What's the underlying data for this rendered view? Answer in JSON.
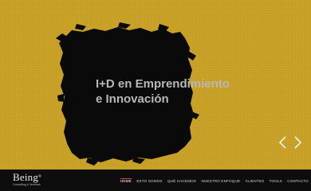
{
  "hero": {
    "headline_line1": "I+D en Emprendimiento",
    "headline_line2": "e Innovación",
    "background_color": "#c9a227",
    "brush_color": "#0a0a0a",
    "prev_icon": "chevron-left-icon",
    "next_icon": "chevron-right-icon"
  },
  "footer": {
    "logo": {
      "word": "Being",
      "mark": "®",
      "tagline": "Consulting & Ventures"
    },
    "nav": [
      {
        "label": "HOME",
        "active": true
      },
      {
        "label": "ESTO SOMOS"
      },
      {
        "label": "QUÉ HACEMOS"
      },
      {
        "label": "NUESTRO ENFOQUE"
      },
      {
        "label": "CLIENTES"
      },
      {
        "label": "TOOLS"
      },
      {
        "label": "CONTACTO"
      }
    ],
    "active_color": "#e0402f"
  }
}
